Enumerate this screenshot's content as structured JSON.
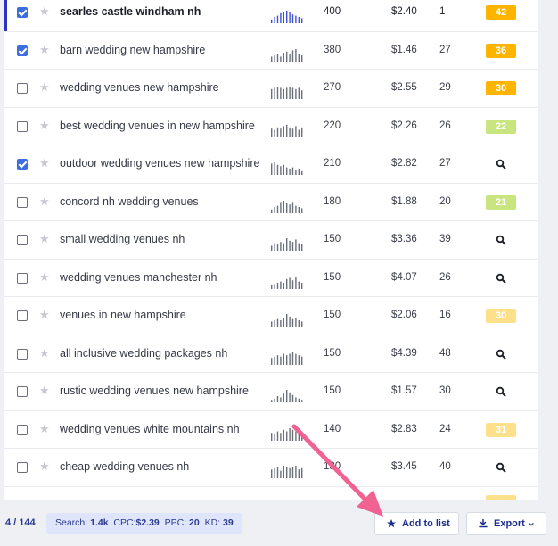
{
  "keywords": {
    "rows": [
      {
        "keyword": "searles castle windham nh",
        "volume": "400",
        "cpc": "$2.40",
        "ppc": "1",
        "kd": "42",
        "kd_color": "#ffb400",
        "checked": true,
        "active": true,
        "spark": [
          3,
          5,
          6,
          8,
          9,
          10,
          9,
          7,
          6,
          5,
          4
        ]
      },
      {
        "keyword": "barn wedding new hampshire",
        "volume": "380",
        "cpc": "$1.46",
        "ppc": "27",
        "kd": "36",
        "kd_color": "#ffb400",
        "checked": true,
        "active": false,
        "spark": [
          4,
          5,
          6,
          4,
          7,
          8,
          6,
          9,
          10,
          6,
          5
        ]
      },
      {
        "keyword": "wedding venues new hampshire",
        "volume": "270",
        "cpc": "$2.55",
        "ppc": "29",
        "kd": "30",
        "kd_color": "#ffb400",
        "checked": false,
        "active": false,
        "spark": [
          8,
          9,
          10,
          9,
          8,
          9,
          10,
          9,
          8,
          9,
          7
        ]
      },
      {
        "keyword": "best wedding venues in new hampshire",
        "volume": "220",
        "cpc": "$2.26",
        "ppc": "26",
        "kd": "22",
        "kd_color": "#c8e57f",
        "checked": false,
        "active": false,
        "spark": [
          7,
          6,
          8,
          7,
          9,
          10,
          8,
          7,
          9,
          6,
          8
        ]
      },
      {
        "keyword": "outdoor wedding venues new hampshire",
        "volume": "210",
        "cpc": "$2.82",
        "ppc": "27",
        "kd": null,
        "kd_color": null,
        "checked": true,
        "active": false,
        "spark": [
          9,
          10,
          8,
          7,
          8,
          6,
          5,
          6,
          4,
          5,
          3
        ]
      },
      {
        "keyword": "concord nh wedding venues",
        "volume": "180",
        "cpc": "$1.88",
        "ppc": "20",
        "kd": "21",
        "kd_color": "#c8e57f",
        "checked": false,
        "active": false,
        "spark": [
          3,
          5,
          6,
          9,
          10,
          8,
          7,
          9,
          6,
          5,
          4
        ]
      },
      {
        "keyword": "small wedding venues nh",
        "volume": "150",
        "cpc": "$3.36",
        "ppc": "39",
        "kd": null,
        "kd_color": null,
        "checked": false,
        "active": false,
        "spark": [
          4,
          6,
          5,
          7,
          6,
          10,
          8,
          7,
          9,
          6,
          5
        ]
      },
      {
        "keyword": "wedding venues manchester nh",
        "volume": "150",
        "cpc": "$4.07",
        "ppc": "26",
        "kd": null,
        "kd_color": null,
        "checked": false,
        "active": false,
        "spark": [
          3,
          4,
          5,
          6,
          5,
          8,
          9,
          7,
          10,
          6,
          5
        ]
      },
      {
        "keyword": "venues in new hampshire",
        "volume": "150",
        "cpc": "$2.06",
        "ppc": "16",
        "kd": "30",
        "kd_color": "#ffe08a",
        "checked": false,
        "active": false,
        "spark": [
          4,
          5,
          6,
          5,
          7,
          10,
          8,
          6,
          7,
          5,
          4
        ]
      },
      {
        "keyword": "all inclusive wedding packages nh",
        "volume": "150",
        "cpc": "$4.39",
        "ppc": "48",
        "kd": null,
        "kd_color": null,
        "checked": false,
        "active": false,
        "spark": [
          5,
          6,
          7,
          6,
          8,
          7,
          8,
          9,
          8,
          7,
          6
        ]
      },
      {
        "keyword": "rustic wedding venues new hampshire",
        "volume": "150",
        "cpc": "$1.57",
        "ppc": "30",
        "kd": null,
        "kd_color": null,
        "checked": false,
        "active": false,
        "spark": [
          2,
          3,
          5,
          4,
          7,
          10,
          8,
          6,
          4,
          3,
          2
        ]
      },
      {
        "keyword": "wedding venues white mountains nh",
        "volume": "140",
        "cpc": "$2.83",
        "ppc": "24",
        "kd": "31",
        "kd_color": "#ffe08a",
        "checked": false,
        "active": false,
        "spark": [
          5,
          4,
          6,
          5,
          7,
          6,
          8,
          7,
          6,
          5,
          6
        ]
      },
      {
        "keyword": "cheap wedding venues nh",
        "volume": "130",
        "cpc": "$3.45",
        "ppc": "40",
        "kd": null,
        "kd_color": null,
        "checked": false,
        "active": false,
        "spark": [
          7,
          8,
          9,
          6,
          10,
          9,
          8,
          9,
          10,
          7,
          8
        ]
      }
    ]
  },
  "footer": {
    "count": "4 / 144",
    "stats_search_label": "Search:",
    "stats_search_value": "1.4k",
    "stats_cpc_label": "CPC:",
    "stats_cpc_value": "$2.39",
    "stats_ppc_label": "PPC:",
    "stats_ppc_value": "20",
    "stats_kd_label": "KD:",
    "stats_kd_value": "39",
    "add_label": "Add to list",
    "export_label": "Export"
  },
  "icons": {
    "star": "star-icon",
    "search": "search-icon",
    "add": "star-icon",
    "export": "download-icon",
    "chevron": "chevron-down-icon"
  },
  "colors": {
    "accent": "#1d2d8c",
    "checkbox": "#3b6fe0",
    "arrow": "#f06292",
    "spark": "#6a6f7c"
  }
}
